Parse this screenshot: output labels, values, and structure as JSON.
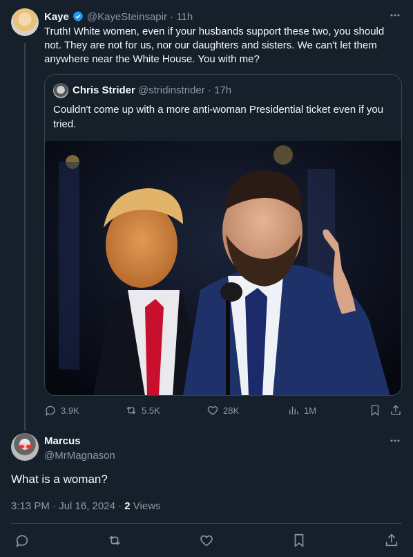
{
  "parent": {
    "name": "Kaye",
    "handle": "@KayeSteinsapir",
    "time": "11h",
    "text": "Truth! White women, even if your husbands support these two, you should not. They are not for us, nor our daughters and sisters. We can't let them anywhere near the White House. You with me?",
    "verified": true,
    "icons": {
      "more": "more-dots-icon",
      "verified": "verified-badge-icon"
    }
  },
  "quote": {
    "name": "Chris Strider",
    "handle": "@stridinstrider",
    "time": "17h",
    "text": "Couldn't come up with a more anti-woman Presidential ticket even if you tried."
  },
  "actions": {
    "replies": "3.9K",
    "reposts": "5.5K",
    "likes": "28K",
    "views": "1M"
  },
  "reply": {
    "name": "Marcus",
    "handle": "@MrMagnason",
    "text": "What is a woman?",
    "timestamp": "3:13 PM · Jul 16, 2024 ·",
    "views_count": "2",
    "views_label": "Views"
  },
  "colors": {
    "background": "#15202b",
    "text": "#f7f9f9",
    "muted": "#8b98a5",
    "border": "#38444d",
    "verified": "#1d9bf0"
  }
}
